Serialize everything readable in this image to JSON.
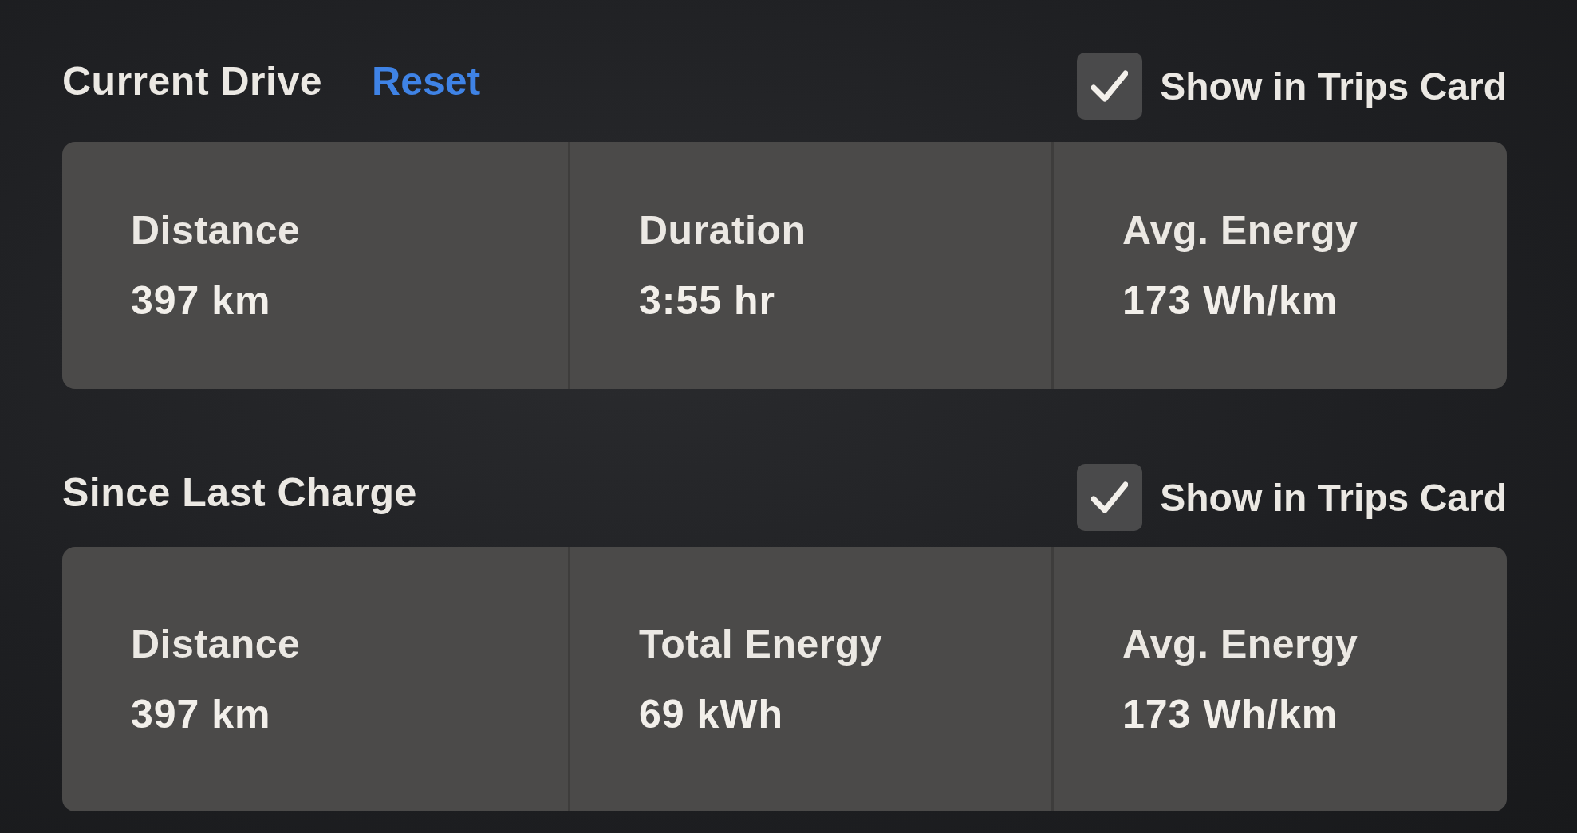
{
  "sections": [
    {
      "title": "Current Drive",
      "reset": "Reset",
      "show_in_trips": {
        "label": "Show in Trips Card",
        "checked": true
      },
      "stats": [
        {
          "label": "Distance",
          "value": "397 km"
        },
        {
          "label": "Duration",
          "value": "3:55 hr"
        },
        {
          "label": "Avg. Energy",
          "value": "173 Wh/km"
        }
      ]
    },
    {
      "title": "Since Last Charge",
      "show_in_trips": {
        "label": "Show in Trips Card",
        "checked": true
      },
      "stats": [
        {
          "label": "Distance",
          "value": "397 km"
        },
        {
          "label": "Total Energy",
          "value": "69 kWh"
        },
        {
          "label": "Avg. Energy",
          "value": "173 Wh/km"
        }
      ]
    }
  ]
}
